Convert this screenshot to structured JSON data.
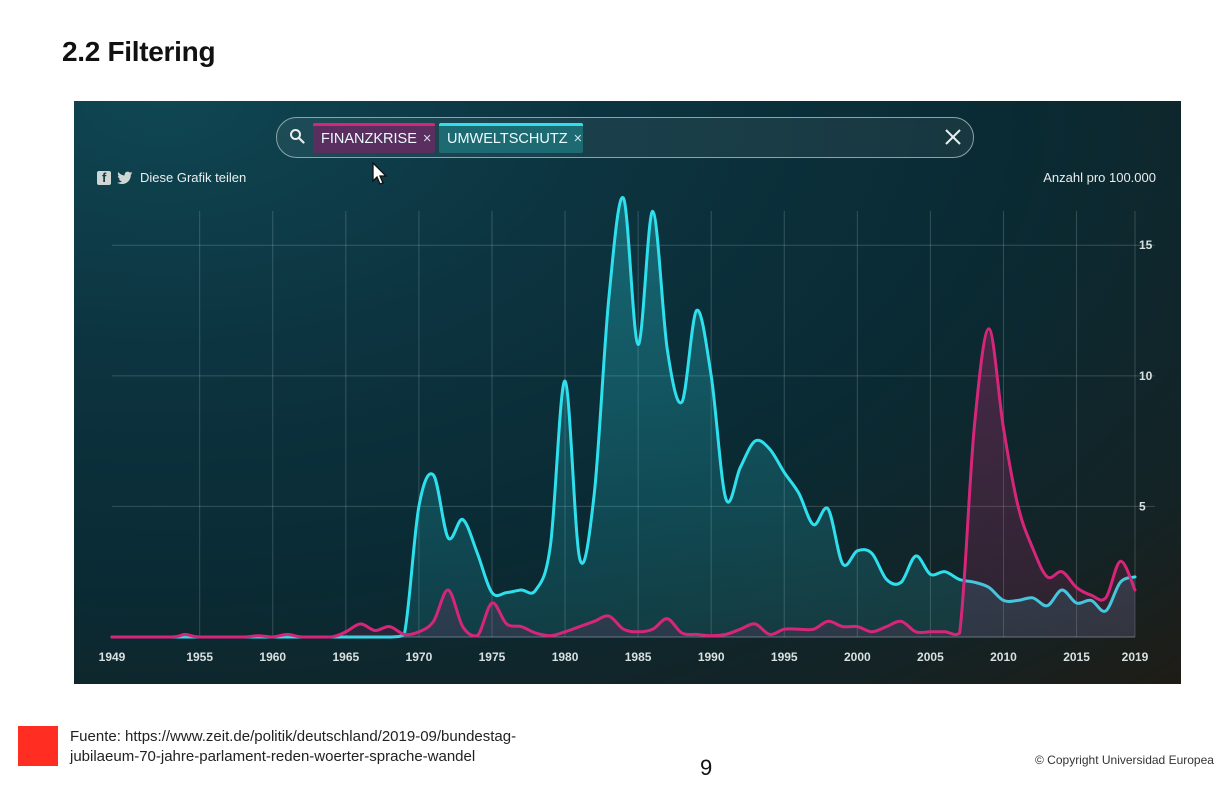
{
  "slide": {
    "title": "2.2 Filtering",
    "source_line1": "Fuente: https://www.zeit.de/politik/deutschland/2019-09/bundestag-",
    "source_line2": "jubilaeum-70-jahre-parlament-reden-woerter-sprache-wandel",
    "page_number": "9",
    "copyright": "© Copyright Universidad Europea"
  },
  "widget": {
    "tags": [
      {
        "label": "FINANZKRISE",
        "remove": "×",
        "color": "#d6267a"
      },
      {
        "label": "UMWELTSCHUTZ",
        "remove": "×",
        "color": "#2ee0ee"
      }
    ],
    "share_text": "Diese Grafik teilen",
    "unit_label": "Anzahl pro 100.000"
  },
  "chart_data": {
    "type": "area",
    "x_ticks": [
      1949,
      1955,
      1960,
      1965,
      1970,
      1975,
      1980,
      1985,
      1990,
      1995,
      2000,
      2005,
      2010,
      2015,
      2019
    ],
    "y_ticks": [
      5,
      10,
      15
    ],
    "xlim": [
      1949,
      2019
    ],
    "ylim": [
      0,
      17
    ],
    "grid": true,
    "series": [
      {
        "name": "UMWELTSCHUTZ",
        "color": "#2ee0ee",
        "points": [
          [
            1949,
            0
          ],
          [
            1955,
            0
          ],
          [
            1960,
            0
          ],
          [
            1965,
            0
          ],
          [
            1968,
            0
          ],
          [
            1969,
            0.1
          ],
          [
            1970,
            5
          ],
          [
            1971,
            6.2
          ],
          [
            1972,
            3.8
          ],
          [
            1973,
            4.5
          ],
          [
            1974,
            3.2
          ],
          [
            1975,
            1.7
          ],
          [
            1976,
            1.7
          ],
          [
            1977,
            1.8
          ],
          [
            1978,
            1.8
          ],
          [
            1979,
            3.5
          ],
          [
            1980,
            9.8
          ],
          [
            1981,
            3
          ],
          [
            1982,
            5.5
          ],
          [
            1983,
            13
          ],
          [
            1984,
            16.8
          ],
          [
            1985,
            11.2
          ],
          [
            1986,
            16.3
          ],
          [
            1987,
            11
          ],
          [
            1988,
            9
          ],
          [
            1989,
            12.5
          ],
          [
            1990,
            10
          ],
          [
            1991,
            5.3
          ],
          [
            1992,
            6.5
          ],
          [
            1993,
            7.5
          ],
          [
            1994,
            7.2
          ],
          [
            1995,
            6.3
          ],
          [
            1996,
            5.5
          ],
          [
            1997,
            4.3
          ],
          [
            1998,
            4.9
          ],
          [
            1999,
            2.8
          ],
          [
            2000,
            3.3
          ],
          [
            2001,
            3.2
          ],
          [
            2002,
            2.2
          ],
          [
            2003,
            2.1
          ],
          [
            2004,
            3.1
          ],
          [
            2005,
            2.4
          ],
          [
            2006,
            2.5
          ],
          [
            2007,
            2.2
          ],
          [
            2008,
            2.1
          ],
          [
            2009,
            1.9
          ],
          [
            2010,
            1.4
          ],
          [
            2011,
            1.4
          ],
          [
            2012,
            1.5
          ],
          [
            2013,
            1.2
          ],
          [
            2014,
            1.8
          ],
          [
            2015,
            1.3
          ],
          [
            2016,
            1.4
          ],
          [
            2017,
            1
          ],
          [
            2018,
            2.1
          ],
          [
            2019,
            2.3
          ]
        ]
      },
      {
        "name": "FINANZKRISE",
        "color": "#d6267a",
        "points": [
          [
            1949,
            0
          ],
          [
            1953,
            0
          ],
          [
            1954,
            0.1
          ],
          [
            1955,
            0
          ],
          [
            1958,
            0
          ],
          [
            1959,
            0.05
          ],
          [
            1960,
            0
          ],
          [
            1961,
            0.1
          ],
          [
            1962,
            0
          ],
          [
            1964,
            0
          ],
          [
            1965,
            0.2
          ],
          [
            1966,
            0.5
          ],
          [
            1967,
            0.25
          ],
          [
            1968,
            0.4
          ],
          [
            1969,
            0.1
          ],
          [
            1970,
            0.2
          ],
          [
            1971,
            0.6
          ],
          [
            1972,
            1.8
          ],
          [
            1973,
            0.4
          ],
          [
            1974,
            0.05
          ],
          [
            1975,
            1.3
          ],
          [
            1976,
            0.5
          ],
          [
            1977,
            0.4
          ],
          [
            1978,
            0.15
          ],
          [
            1979,
            0.05
          ],
          [
            1980,
            0.2
          ],
          [
            1981,
            0.4
          ],
          [
            1982,
            0.6
          ],
          [
            1983,
            0.8
          ],
          [
            1984,
            0.3
          ],
          [
            1985,
            0.2
          ],
          [
            1986,
            0.3
          ],
          [
            1987,
            0.7
          ],
          [
            1988,
            0.15
          ],
          [
            1989,
            0.1
          ],
          [
            1990,
            0.05
          ],
          [
            1991,
            0.1
          ],
          [
            1992,
            0.3
          ],
          [
            1993,
            0.5
          ],
          [
            1994,
            0.1
          ],
          [
            1995,
            0.3
          ],
          [
            1996,
            0.3
          ],
          [
            1997,
            0.3
          ],
          [
            1998,
            0.6
          ],
          [
            1999,
            0.4
          ],
          [
            2000,
            0.4
          ],
          [
            2001,
            0.2
          ],
          [
            2002,
            0.4
          ],
          [
            2003,
            0.6
          ],
          [
            2004,
            0.2
          ],
          [
            2005,
            0.2
          ],
          [
            2006,
            0.2
          ],
          [
            2007,
            0.15
          ],
          [
            2008,
            8
          ],
          [
            2009,
            11.8
          ],
          [
            2010,
            8
          ],
          [
            2011,
            5
          ],
          [
            2012,
            3.4
          ],
          [
            2013,
            2.3
          ],
          [
            2014,
            2.5
          ],
          [
            2015,
            1.9
          ],
          [
            2016,
            1.6
          ],
          [
            2017,
            1.5
          ],
          [
            2018,
            2.9
          ],
          [
            2019,
            1.8
          ]
        ]
      }
    ]
  }
}
